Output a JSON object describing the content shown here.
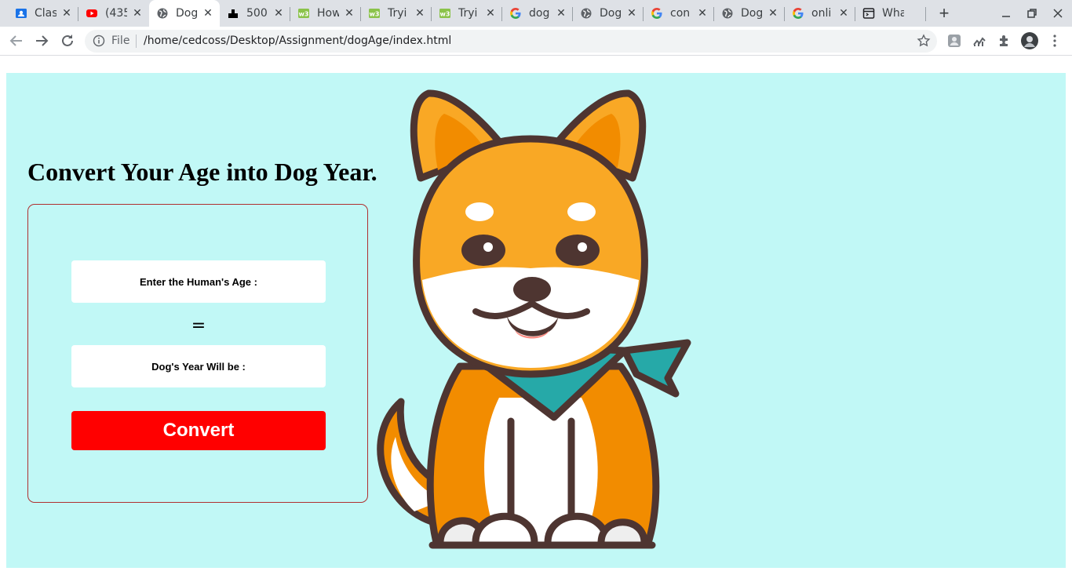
{
  "browser": {
    "tabs": [
      {
        "title": "Clas",
        "icon": "classroom-icon"
      },
      {
        "title": "(435",
        "icon": "youtube-icon"
      },
      {
        "title": "Dog",
        "icon": "globe-icon",
        "active": true
      },
      {
        "title": "500",
        "icon": "site-icon"
      },
      {
        "title": "How",
        "icon": "w3schools-icon"
      },
      {
        "title": "Tryi",
        "icon": "w3schools-icon"
      },
      {
        "title": "Tryi",
        "icon": "w3schools-icon"
      },
      {
        "title": "dog",
        "icon": "google-icon"
      },
      {
        "title": "Dog",
        "icon": "globe-icon"
      },
      {
        "title": "con",
        "icon": "google-icon"
      },
      {
        "title": "Dog",
        "icon": "globe-icon"
      },
      {
        "title": "onli",
        "icon": "google-icon"
      },
      {
        "title": "Wha",
        "icon": "code-window-icon"
      }
    ],
    "new_tab_label": "+",
    "close_glyph": "✕",
    "address": {
      "scheme_label": "File",
      "url": "/home/cedcoss/Desktop/Assignment/dogAge/index.html"
    }
  },
  "page": {
    "heading": "Convert Your Age into Dog Year.",
    "human_age_placeholder": "Enter the Human's Age :",
    "equals_sign": "=",
    "dog_year_placeholder": "Dog's Year Will be :",
    "convert_label": "Convert"
  },
  "colors": {
    "page_background": "#c1f8f6",
    "card_border": "#b03030",
    "button": "#ff0000",
    "button_text": "#ffffff",
    "dog_orange": "#f9a825",
    "dog_outline": "#4e3531",
    "bandana": "#26a9a8"
  }
}
